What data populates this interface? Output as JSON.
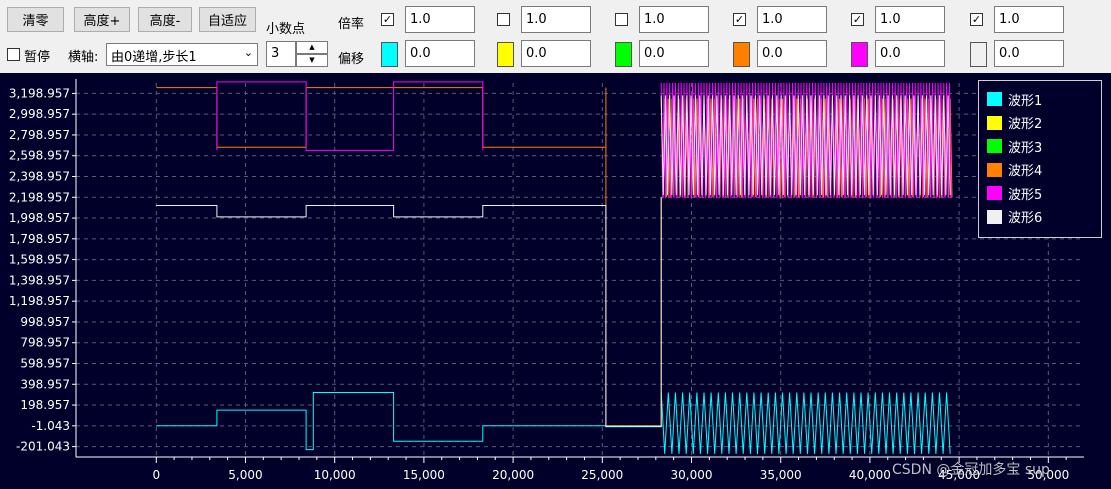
{
  "toolbar": {
    "clear_label": "清零",
    "height_plus_label": "高度+",
    "height_minus_label": "高度-",
    "autofit_label": "自适应",
    "pause_label": "暂停",
    "pause_checked": false,
    "xaxis_label": "横轴:",
    "xaxis_value": "由0递增,步长1",
    "decimals_label": "小数点",
    "decimals_value": "3",
    "scale_label": "倍率",
    "offset_label": "偏移"
  },
  "channels": [
    {
      "enabled": true,
      "scale": "1.0",
      "offset": "0.0",
      "color": "#00ffff"
    },
    {
      "enabled": false,
      "scale": "1.0",
      "offset": "0.0",
      "color": "#ffff00"
    },
    {
      "enabled": false,
      "scale": "1.0",
      "offset": "0.0",
      "color": "#00ff00"
    },
    {
      "enabled": true,
      "scale": "1.0",
      "offset": "0.0",
      "color": "#ff8000"
    },
    {
      "enabled": true,
      "scale": "1.0",
      "offset": "0.0",
      "color": "#ff00ff"
    },
    {
      "enabled": true,
      "scale": "1.0",
      "offset": "0.0",
      "color": "#f0f0f0"
    }
  ],
  "legend": [
    {
      "name": "波形1",
      "color": "#00ffff"
    },
    {
      "name": "波形2",
      "color": "#ffff00"
    },
    {
      "name": "波形3",
      "color": "#00ff00"
    },
    {
      "name": "波形4",
      "color": "#ff8000"
    },
    {
      "name": "波形5",
      "color": "#ff00ff"
    },
    {
      "name": "波形6",
      "color": "#f0f0f0"
    }
  ],
  "chart_data": {
    "type": "line",
    "xlim": [
      -4500,
      52000
    ],
    "ylim": [
      -301.043,
      3298.957
    ],
    "x_ticks": [
      "0",
      "5,000",
      "10,000",
      "15,000",
      "20,000",
      "25,000",
      "30,000",
      "35,000",
      "40,000",
      "45,000",
      "50,000"
    ],
    "x_tick_values": [
      0,
      5000,
      10000,
      15000,
      20000,
      25000,
      30000,
      35000,
      40000,
      45000,
      50000
    ],
    "y_ticks": [
      "3,198.957",
      "2,998.957",
      "2,798.957",
      "2,598.957",
      "2,398.957",
      "2,198.957",
      "1,998.957",
      "1,798.957",
      "1,598.957",
      "1,398.957",
      "1,198.957",
      "998.957",
      "798.957",
      "598.957",
      "398.957",
      "198.957",
      "-1.043",
      "-201.043"
    ],
    "y_tick_values": [
      3198.957,
      2998.957,
      2798.957,
      2598.957,
      2398.957,
      2198.957,
      1998.957,
      1798.957,
      1598.957,
      1398.957,
      1198.957,
      998.957,
      798.957,
      598.957,
      398.957,
      198.957,
      -1.043,
      -201.043
    ],
    "grid": true,
    "legend_position": "top-right",
    "series": [
      {
        "name": "波形1",
        "color": "#00ffff",
        "points": [
          [
            0,
            0
          ],
          [
            3400,
            0
          ],
          [
            3400,
            150
          ],
          [
            8400,
            150
          ],
          [
            8400,
            -230
          ],
          [
            8800,
            -230
          ],
          [
            8800,
            320
          ],
          [
            13300,
            320
          ],
          [
            13300,
            -150
          ],
          [
            18300,
            -150
          ],
          [
            18300,
            0
          ],
          [
            25200,
            0
          ],
          [
            25200,
            -10
          ],
          [
            28300,
            -10
          ],
          [
            28300,
            0
          ]
        ],
        "osc": {
          "from": 28300,
          "to": 44600,
          "low": -270,
          "high": 320,
          "period": 400
        }
      },
      {
        "name": "波形4",
        "color": "#ff8000",
        "points": [
          [
            0,
            3255
          ],
          [
            3400,
            3255
          ],
          [
            3400,
            2680
          ],
          [
            8400,
            2680
          ],
          [
            8400,
            3255
          ],
          [
            18300,
            3255
          ],
          [
            18300,
            2680
          ],
          [
            25200,
            2680
          ],
          [
            25200,
            3255
          ],
          [
            25200,
            0
          ],
          [
            28300,
            0
          ],
          [
            28300,
            2200
          ]
        ],
        "osc": {
          "from": 28300,
          "to": 44600,
          "low": 2200,
          "high": 3150,
          "period": 200
        }
      },
      {
        "name": "波形5",
        "color": "#ff00ff",
        "points": [
          [
            3400,
            2650
          ],
          [
            3400,
            3310
          ],
          [
            8400,
            3310
          ],
          [
            8400,
            2650
          ],
          [
            13300,
            2650
          ],
          [
            13300,
            3310
          ],
          [
            18300,
            3310
          ],
          [
            18300,
            2650
          ]
        ],
        "osc": {
          "from": 28300,
          "to": 44600,
          "low": 2190,
          "high": 3300,
          "period": 160
        }
      },
      {
        "name": "波形6",
        "color": "#f0f0f0",
        "points": [
          [
            0,
            2120
          ],
          [
            3400,
            2120
          ],
          [
            3400,
            2010
          ],
          [
            8400,
            2010
          ],
          [
            8400,
            2120
          ],
          [
            13300,
            2120
          ],
          [
            13300,
            2010
          ],
          [
            18300,
            2010
          ],
          [
            18300,
            2120
          ],
          [
            25200,
            2120
          ],
          [
            25200,
            -5
          ],
          [
            28300,
            -5
          ],
          [
            28300,
            2200
          ]
        ],
        "osc": {
          "from": 28300,
          "to": 44600,
          "low": 2220,
          "high": 3180,
          "period": 240
        }
      }
    ]
  },
  "watermark": "CSDN @金冠加多宝 sup"
}
